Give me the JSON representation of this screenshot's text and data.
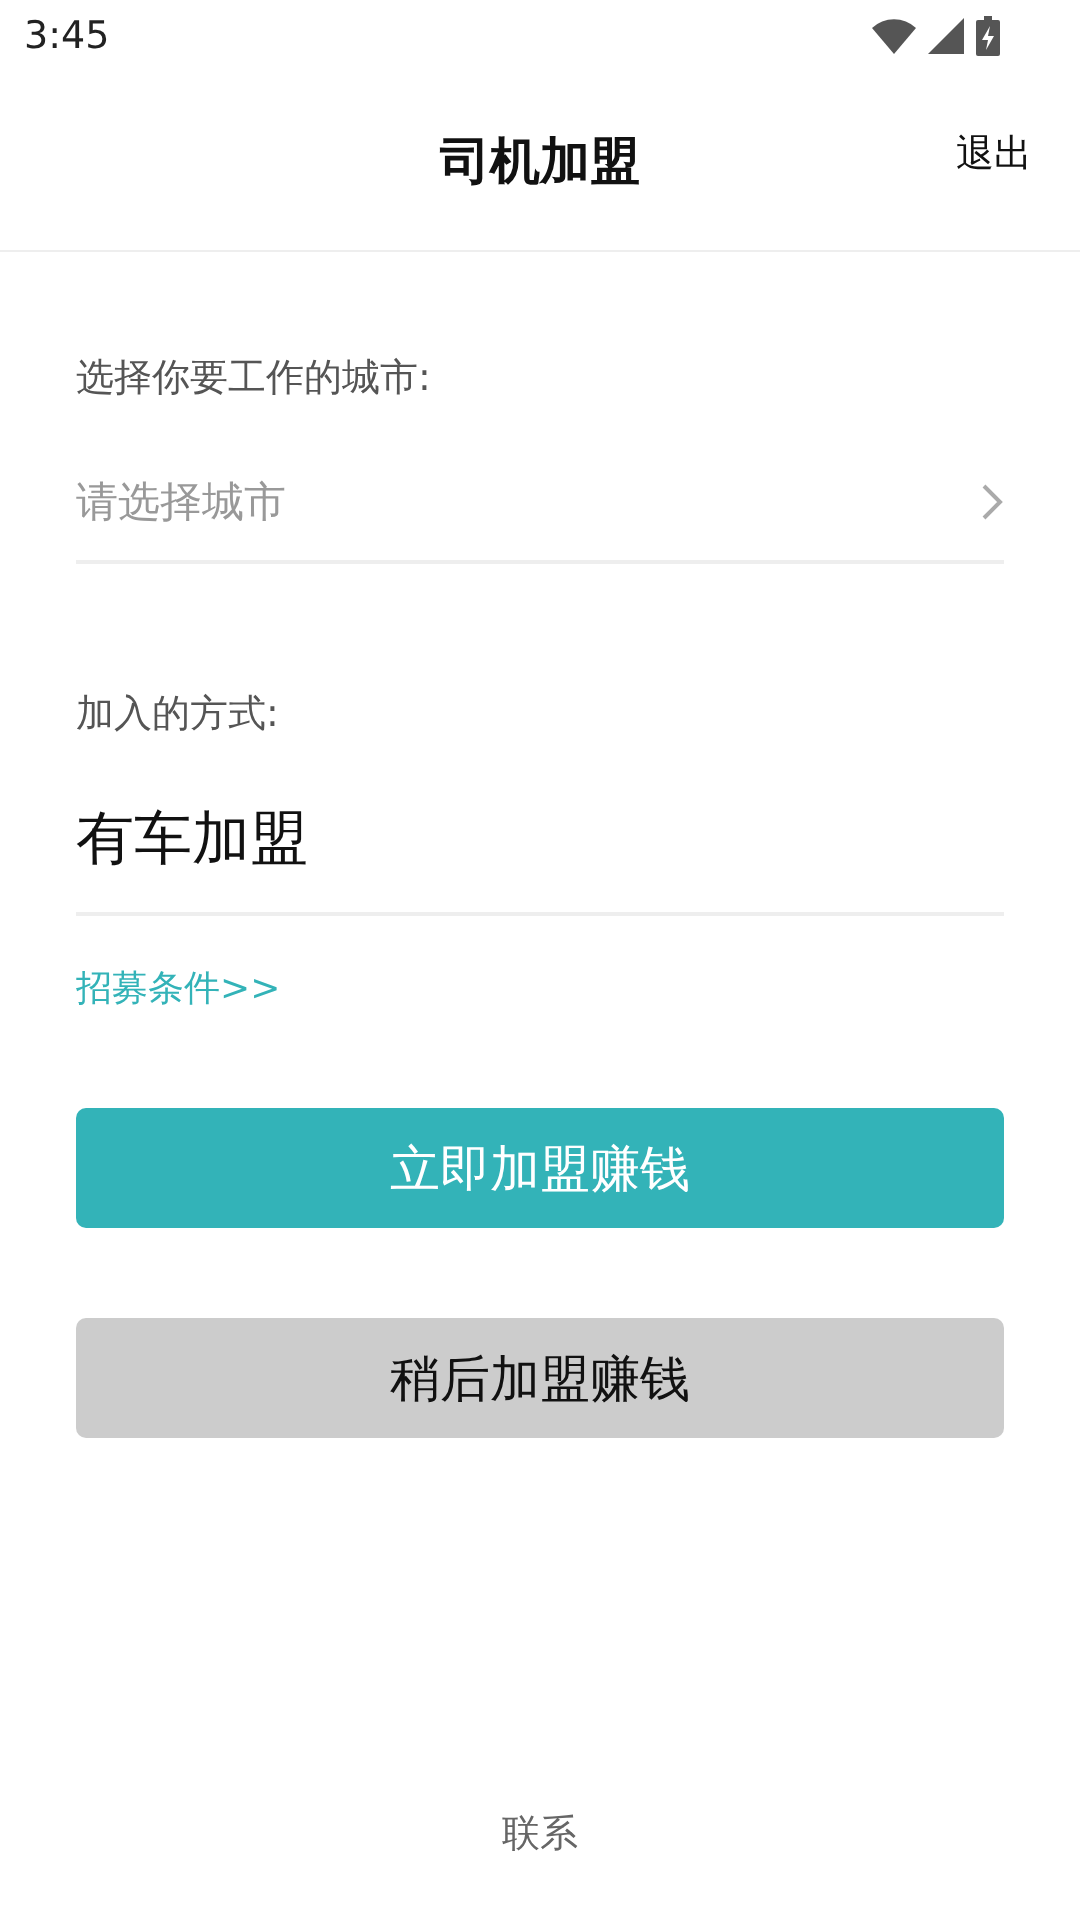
{
  "status_bar": {
    "time": "3:45"
  },
  "header": {
    "title": "司机加盟",
    "action": "退出"
  },
  "city": {
    "label": "选择你要工作的城市:",
    "placeholder": "请选择城市"
  },
  "mode": {
    "label": "加入的方式:",
    "value": "有车加盟"
  },
  "link": "招募条件>>",
  "buttons": [
    {
      "label": "立即加盟赚钱",
      "kind": "primary"
    },
    {
      "label": "稍后加盟赚钱",
      "kind": "secondary"
    }
  ],
  "footer": "联系"
}
